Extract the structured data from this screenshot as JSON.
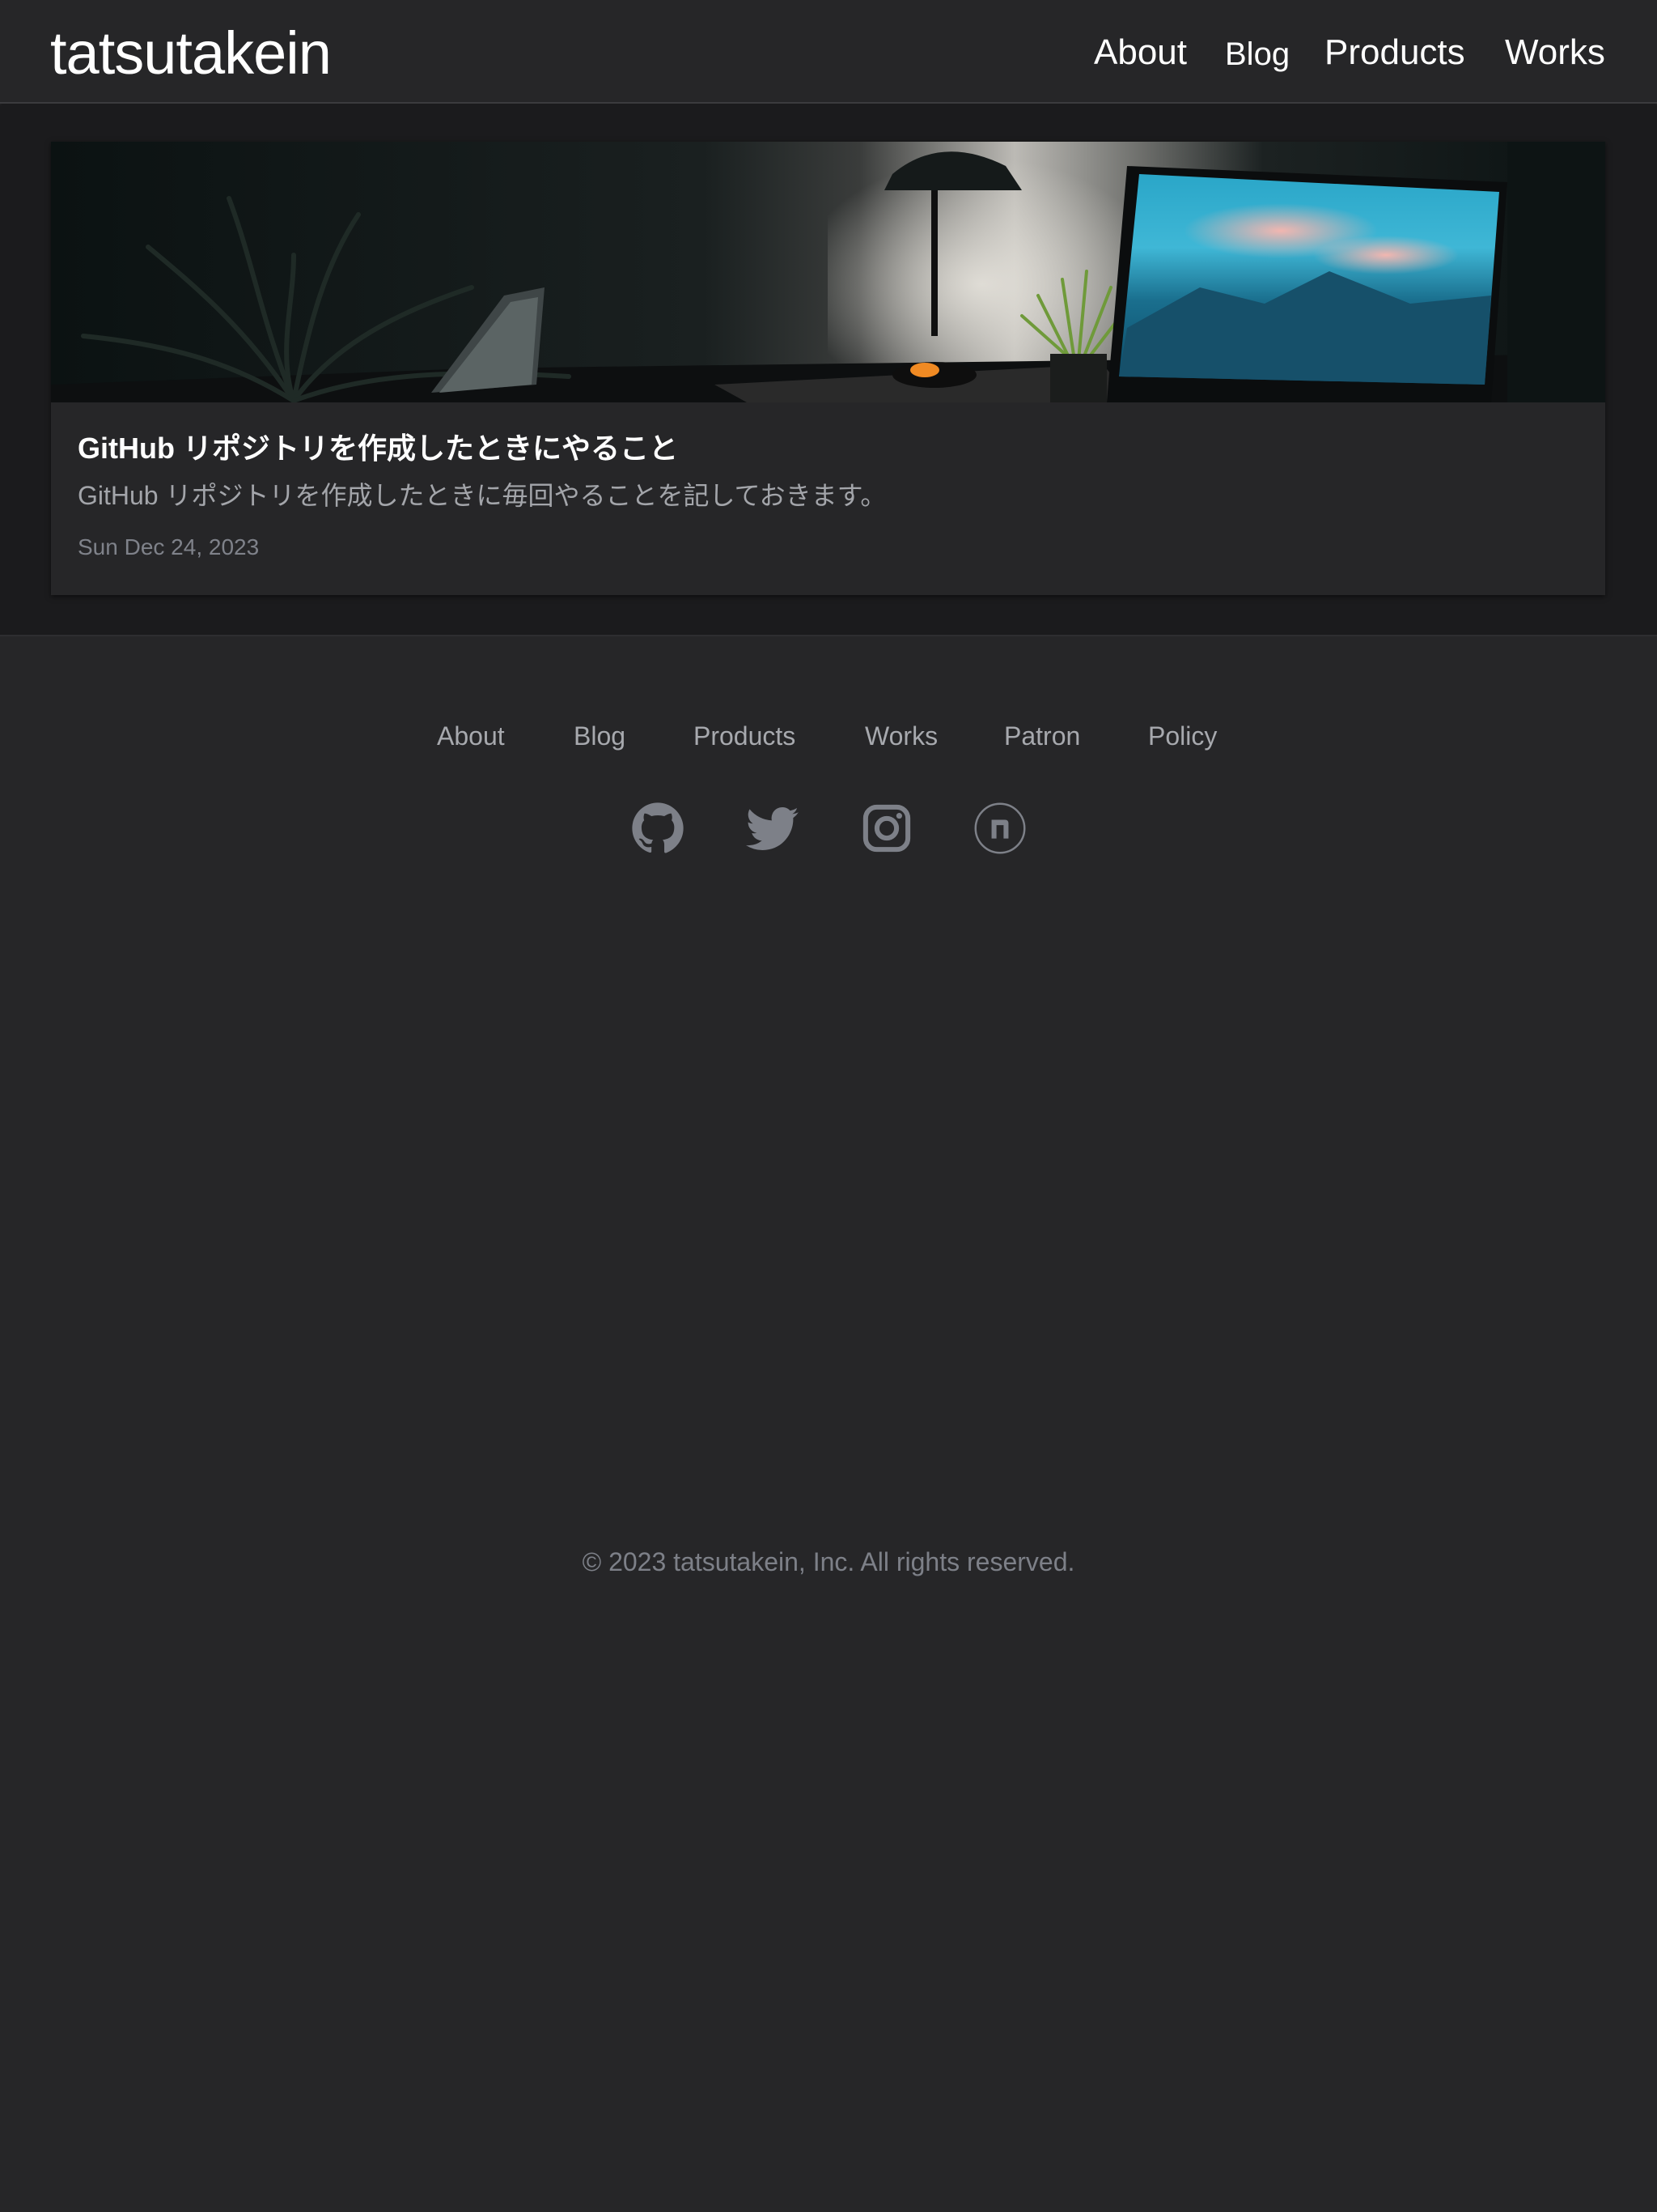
{
  "site": {
    "logo_text": "tatsutakein"
  },
  "header": {
    "nav": [
      {
        "label": "About"
      },
      {
        "label": "Blog"
      },
      {
        "label": "Products"
      },
      {
        "label": "Works"
      }
    ]
  },
  "main": {
    "posts": [
      {
        "title": "GitHub リポジトリを作成したときにやること",
        "description": "GitHub リポジトリを作成したときに毎回やることを記しておきます。",
        "date": "Sun Dec 24, 2023",
        "hero_image": "desk-setup-photo"
      }
    ]
  },
  "footer": {
    "nav": [
      {
        "label": "About"
      },
      {
        "label": "Blog"
      },
      {
        "label": "Products"
      },
      {
        "label": "Works"
      },
      {
        "label": "Patron"
      },
      {
        "label": "Policy"
      }
    ],
    "social": [
      {
        "icon": "github-icon"
      },
      {
        "icon": "twitter-icon"
      },
      {
        "icon": "instagram-icon"
      },
      {
        "icon": "note-icon"
      }
    ],
    "copyright": "© 2023 tatsutakein, Inc. All rights reserved."
  },
  "colors": {
    "background": "#262628",
    "main_background": "#1b1b1d",
    "text_primary": "#ffffff",
    "text_muted": "#a3a5aa",
    "icon_gray": "#7d8088"
  }
}
